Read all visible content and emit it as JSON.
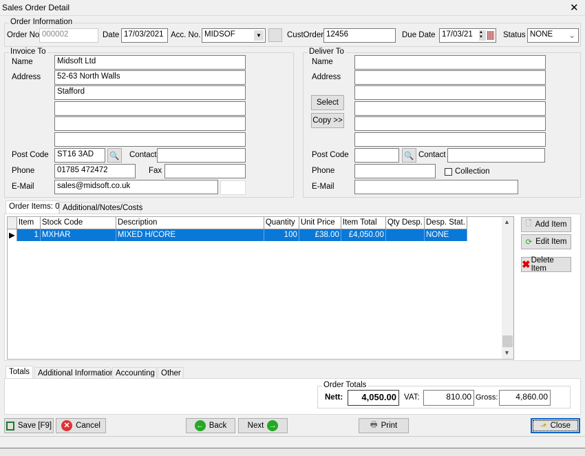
{
  "window": {
    "title": "Sales Order Detail",
    "close": "✕"
  },
  "order_info": {
    "group": "Order Information",
    "order_no_label": "Order No.",
    "order_no": "000002",
    "date_label": "Date",
    "date": "17/03/2021",
    "acc_label": "Acc. No.",
    "acc": "MIDSOF",
    "custorder_label": "CustOrder",
    "custorder": "12456",
    "due_label": "Due Date",
    "due": "17/03/21",
    "status_label": "Status",
    "status": "NONE"
  },
  "invoice": {
    "group": "Invoice To",
    "name_label": "Name",
    "name": "Midsoft Ltd",
    "address_label": "Address",
    "address": [
      "52-63 North Walls",
      "Stafford",
      "",
      "",
      ""
    ],
    "postcode_label": "Post Code",
    "postcode": "ST16 3AD",
    "contact_label": "Contact",
    "contact": "",
    "phone_label": "Phone",
    "phone": "01785 472472",
    "fax_label": "Fax",
    "fax": "",
    "email_label": "E-Mail",
    "email": "sales@midsoft.co.uk"
  },
  "deliver": {
    "group": "Deliver To",
    "name_label": "Name",
    "address_label": "Address",
    "select": "Select",
    "copy": "Copy >>",
    "postcode_label": "Post Code",
    "contact_label": "Contact",
    "phone_label": "Phone",
    "collection": "Collection",
    "email_label": "E-Mail"
  },
  "items_tabs": [
    "Order Items: 0",
    "Additional/Notes/Costs"
  ],
  "grid": {
    "columns": [
      "Item",
      "Stock Code",
      "Description",
      "Quantity",
      "Unit Price",
      "Item Total",
      "Qty Desp.",
      "Desp. Stat."
    ],
    "rows": [
      [
        "1",
        "MXHAR",
        "MIXED H/CORE",
        "100",
        "£38.00",
        "£4,050.00",
        "",
        "NONE"
      ]
    ]
  },
  "item_buttons": {
    "add": "Add Item",
    "edit": "Edit Item",
    "delete": "Delete Item"
  },
  "bottom_tabs": [
    "Totals",
    "Additional Information",
    "Accounting",
    "Other"
  ],
  "totals": {
    "group": "Order Totals",
    "nett_label": "Nett:",
    "nett": "4,050.00",
    "vat_label": "VAT:",
    "vat": "810.00",
    "gross_label": "Gross:",
    "gross": "4,860.00"
  },
  "footer": {
    "save": "Save [F9]",
    "cancel": "Cancel",
    "back": "Back",
    "next": "Next",
    "print": "Print",
    "close": "Close"
  }
}
